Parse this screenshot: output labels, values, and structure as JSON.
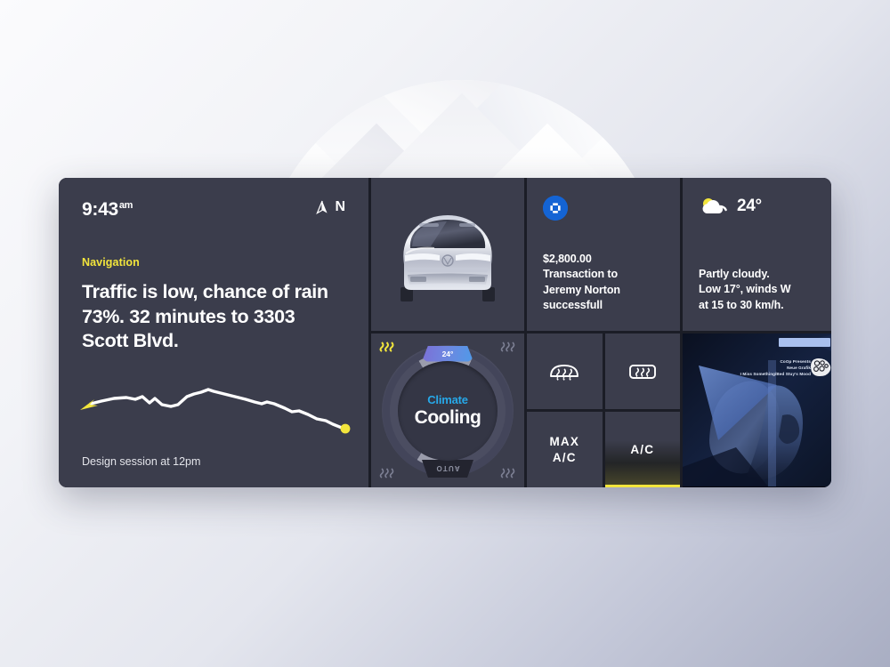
{
  "navigation": {
    "clock_time": "9:43",
    "clock_meridiem": "am",
    "compass_label": "N",
    "compass_icon": "compass-needle-icon",
    "section_label": "Navigation",
    "headline": "Traffic is low, chance of rain 73%. 32 minutes to 3303 Scott Blvd.",
    "footer": "Design session at 12pm",
    "accent_color": "#f2e53c"
  },
  "vehicle": {
    "image_alt": "car-front-view"
  },
  "climate": {
    "sub_label": "Climate",
    "main_label": "Cooling",
    "temperature": "24°",
    "auto_label": "AUTO",
    "sub_color": "#27a8e8",
    "seat_heaters": [
      {
        "position": "top-left",
        "active": true
      },
      {
        "position": "top-right",
        "active": false
      },
      {
        "position": "bottom-left",
        "active": false
      },
      {
        "position": "bottom-right",
        "active": false
      }
    ]
  },
  "transaction": {
    "bank_icon": "bank-logo-icon",
    "amount": "$2,800.00",
    "line2": "Transaction to",
    "line3": "Jeremy Norton",
    "line4": "successfull"
  },
  "controls": {
    "front_defrost_icon": "front-defrost-icon",
    "rear_defrost_icon": "rear-defrost-icon",
    "max_ac_label": "MAX\nA/C",
    "max_ac_line1": "MAX",
    "max_ac_line2": "A/C",
    "ac_label": "A/C",
    "ac_active": true,
    "active_color": "#f2e53c"
  },
  "weather": {
    "icon": "partly-cloudy-icon",
    "temperature": "24°",
    "line1": "Partly cloudy.",
    "line2": "Low 17°, winds W",
    "line3": "at 15 to 30 km/h."
  },
  "media": {
    "credit_line1": "CoOp Presents",
    "credit_line2": "Neue Grafik",
    "credit_line3": "I Miss Something/Bed Stuy's Mood",
    "logo_icon": "record-label-logo-icon"
  }
}
